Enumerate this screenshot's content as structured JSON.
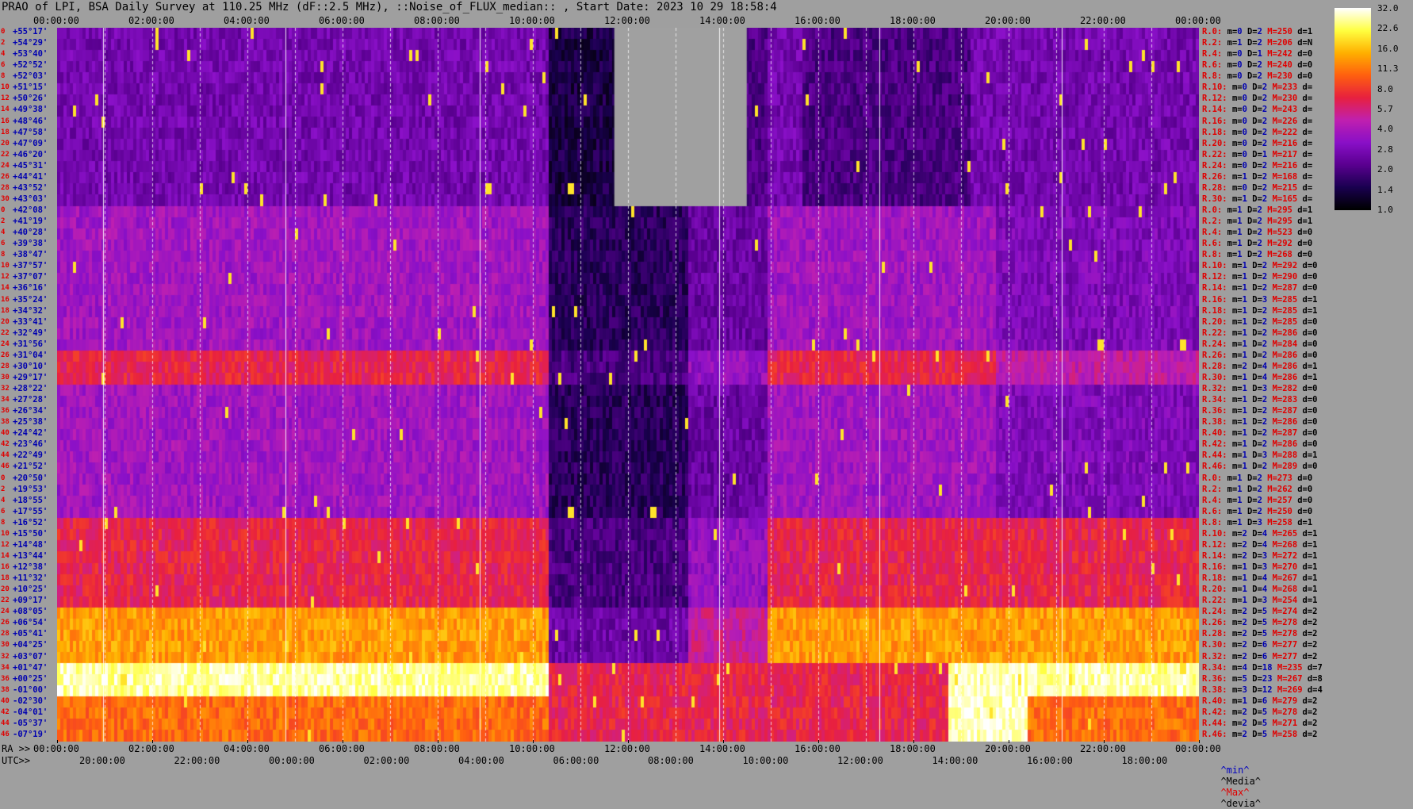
{
  "title": "PRAO of LPI, BSA Daily Survey at 110.25 MHz (dF::2.5 MHz), ::Noise_of_FLUX_median:: , Start Date: 2023 10 29 18:58:4",
  "axes": {
    "top_ticks": [
      "00:00:00",
      "02:00:00",
      "04:00:00",
      "06:00:00",
      "08:00:00",
      "10:00:00",
      "12:00:00",
      "14:00:00",
      "16:00:00",
      "18:00:00",
      "20:00:00",
      "22:00:00",
      "00:00:00"
    ],
    "bottom_ra_prefix": "RA >>",
    "bottom_ra_ticks": [
      "00:00:00",
      "02:00:00",
      "04:00:00",
      "06:00:00",
      "08:00:00",
      "10:00:00",
      "12:00:00",
      "14:00:00",
      "16:00:00",
      "18:00:00",
      "20:00:00",
      "22:00:00",
      "00:00:00"
    ],
    "bottom_utc_prefix": "UTC>>",
    "bottom_utc_ticks": [
      "20:00:00",
      "22:00:00",
      "00:00:00",
      "02:00:00",
      "04:00:00",
      "06:00:00",
      "08:00:00",
      "10:00:00",
      "12:00:00",
      "14:00:00",
      "16:00:00",
      "18:00:00"
    ]
  },
  "colorbar": {
    "ticks": [
      "32.0",
      "22.6",
      "16.0",
      "11.3",
      "8.0",
      "5.7",
      "4.0",
      "2.8",
      "2.0",
      "1.4",
      "1.0"
    ]
  },
  "legend_footer": {
    "min": "^min^",
    "median": "^Media^",
    "max": "^Max^",
    "devia": "^devia^"
  },
  "chart_data": {
    "type": "heatmap",
    "x_axis": "RA 00:00:00 to 24:00:00",
    "declinations": [
      "+55°17'",
      "+54°29'",
      "+53°40'",
      "+52°52'",
      "+52°03'",
      "+51°15'",
      "+50°26'",
      "+49°38'",
      "+48°46'",
      "+47°58'",
      "+47°09'",
      "+46°20'",
      "+45°31'",
      "+44°41'",
      "+43°52'",
      "+43°03'",
      "+42°08'",
      "+41°19'",
      "+40°28'",
      "+39°38'",
      "+38°47'",
      "+37°57'",
      "+37°07'",
      "+36°16'",
      "+35°24'",
      "+34°32'",
      "+33°41'",
      "+32°49'",
      "+31°56'",
      "+31°04'",
      "+30°10'",
      "+29°17'",
      "+28°22'",
      "+27°28'",
      "+26°34'",
      "+25°38'",
      "+24°42'",
      "+23°46'",
      "+22°49'",
      "+21°52'",
      "+20°50'",
      "+19°53'",
      "+18°55'",
      "+17°55'",
      "+16°52'",
      "+15°50'",
      "+14°48'",
      "+13°44'",
      "+12°38'",
      "+11°32'",
      "+10°25'",
      "+09°17'",
      "+08°05'",
      "+06°54'",
      "+05°41'",
      "+04°25'",
      "+03°07'",
      "+01°47'",
      "+00°25'",
      "-01°00'",
      "-02°30'",
      "-04°01'",
      "-05°37'",
      "-07°19'"
    ],
    "row_numbers": [
      "0",
      "2",
      "4",
      "6",
      "8",
      "10",
      "12",
      "14",
      "16",
      "18",
      "20",
      "22",
      "24",
      "26",
      "28",
      "30",
      "0",
      "2",
      "4",
      "6",
      "8",
      "10",
      "12",
      "14",
      "16",
      "18",
      "20",
      "22",
      "24",
      "26",
      "28",
      "30",
      "32",
      "34",
      "36",
      "38",
      "40",
      "42",
      "44",
      "46",
      "0",
      "2",
      "4",
      "6",
      "8",
      "10",
      "12",
      "14",
      "16",
      "18",
      "20",
      "22",
      "24",
      "26",
      "28",
      "30",
      "32",
      "34",
      "36",
      "38",
      "40",
      "42",
      "44",
      "46"
    ],
    "stats": [
      {
        "r": "R.0:",
        "m": "0",
        "D": "2",
        "M": "250",
        "d": "1"
      },
      {
        "r": "R.2:",
        "m": "1",
        "D": "2",
        "M": "206",
        "d": "N"
      },
      {
        "r": "R.4:",
        "m": "0",
        "D": "1",
        "M": "242",
        "d": "0"
      },
      {
        "r": "R.6:",
        "m": "0",
        "D": "2",
        "M": "240",
        "d": "0"
      },
      {
        "r": "R.8:",
        "m": "0",
        "D": "2",
        "M": "230",
        "d": "0"
      },
      {
        "r": "R.10:",
        "m": "0",
        "D": "2",
        "M": "233",
        "d": ""
      },
      {
        "r": "R.12:",
        "m": "0",
        "D": "2",
        "M": "230",
        "d": ""
      },
      {
        "r": "R.14:",
        "m": "0",
        "D": "2",
        "M": "243",
        "d": ""
      },
      {
        "r": "R.16:",
        "m": "0",
        "D": "2",
        "M": "226",
        "d": ""
      },
      {
        "r": "R.18:",
        "m": "0",
        "D": "2",
        "M": "222",
        "d": ""
      },
      {
        "r": "R.20:",
        "m": "0",
        "D": "2",
        "M": "216",
        "d": ""
      },
      {
        "r": "R.22:",
        "m": "0",
        "D": "1",
        "M": "217",
        "d": ""
      },
      {
        "r": "R.24:",
        "m": "0",
        "D": "2",
        "M": "216",
        "d": ""
      },
      {
        "r": "R.26:",
        "m": "1",
        "D": "2",
        "M": "168",
        "d": ""
      },
      {
        "r": "R.28:",
        "m": "0",
        "D": "2",
        "M": "215",
        "d": ""
      },
      {
        "r": "R.30:",
        "m": "1",
        "D": "2",
        "M": "165",
        "d": ""
      },
      {
        "r": "R.0:",
        "m": "1",
        "D": "2",
        "M": "295",
        "d": "1"
      },
      {
        "r": "R.2:",
        "m": "1",
        "D": "2",
        "M": "295",
        "d": "1"
      },
      {
        "r": "R.4:",
        "m": "1",
        "D": "2",
        "M": "523",
        "d": "0"
      },
      {
        "r": "R.6:",
        "m": "1",
        "D": "2",
        "M": "292",
        "d": "0"
      },
      {
        "r": "R.8:",
        "m": "1",
        "D": "2",
        "M": "268",
        "d": "0"
      },
      {
        "r": "R.10:",
        "m": "1",
        "D": "2",
        "M": "292",
        "d": "0"
      },
      {
        "r": "R.12:",
        "m": "1",
        "D": "2",
        "M": "290",
        "d": "0"
      },
      {
        "r": "R.14:",
        "m": "1",
        "D": "2",
        "M": "287",
        "d": "0"
      },
      {
        "r": "R.16:",
        "m": "1",
        "D": "3",
        "M": "285",
        "d": "1"
      },
      {
        "r": "R.18:",
        "m": "1",
        "D": "2",
        "M": "285",
        "d": "1"
      },
      {
        "r": "R.20:",
        "m": "1",
        "D": "2",
        "M": "285",
        "d": "0"
      },
      {
        "r": "R.22:",
        "m": "1",
        "D": "2",
        "M": "286",
        "d": "0"
      },
      {
        "r": "R.24:",
        "m": "1",
        "D": "2",
        "M": "284",
        "d": "0"
      },
      {
        "r": "R.26:",
        "m": "1",
        "D": "2",
        "M": "286",
        "d": "0"
      },
      {
        "r": "R.28:",
        "m": "2",
        "D": "4",
        "M": "286",
        "d": "1"
      },
      {
        "r": "R.30:",
        "m": "1",
        "D": "4",
        "M": "286",
        "d": "1"
      },
      {
        "r": "R.32:",
        "m": "1",
        "D": "3",
        "M": "282",
        "d": "0"
      },
      {
        "r": "R.34:",
        "m": "1",
        "D": "2",
        "M": "283",
        "d": "0"
      },
      {
        "r": "R.36:",
        "m": "1",
        "D": "2",
        "M": "287",
        "d": "0"
      },
      {
        "r": "R.38:",
        "m": "1",
        "D": "2",
        "M": "286",
        "d": "0"
      },
      {
        "r": "R.40:",
        "m": "1",
        "D": "2",
        "M": "287",
        "d": "0"
      },
      {
        "r": "R.42:",
        "m": "1",
        "D": "2",
        "M": "286",
        "d": "0"
      },
      {
        "r": "R.44:",
        "m": "1",
        "D": "3",
        "M": "288",
        "d": "1"
      },
      {
        "r": "R.46:",
        "m": "1",
        "D": "2",
        "M": "289",
        "d": "0"
      },
      {
        "r": "R.0:",
        "m": "1",
        "D": "2",
        "M": "273",
        "d": "0"
      },
      {
        "r": "R.2:",
        "m": "1",
        "D": "2",
        "M": "262",
        "d": "0"
      },
      {
        "r": "R.4:",
        "m": "1",
        "D": "2",
        "M": "257",
        "d": "0"
      },
      {
        "r": "R.6:",
        "m": "1",
        "D": "2",
        "M": "250",
        "d": "0"
      },
      {
        "r": "R.8:",
        "m": "1",
        "D": "3",
        "M": "258",
        "d": "1"
      },
      {
        "r": "R.10:",
        "m": "2",
        "D": "4",
        "M": "265",
        "d": "1"
      },
      {
        "r": "R.12:",
        "m": "2",
        "D": "4",
        "M": "268",
        "d": "1"
      },
      {
        "r": "R.14:",
        "m": "2",
        "D": "3",
        "M": "272",
        "d": "1"
      },
      {
        "r": "R.16:",
        "m": "1",
        "D": "3",
        "M": "270",
        "d": "1"
      },
      {
        "r": "R.18:",
        "m": "1",
        "D": "4",
        "M": "267",
        "d": "1"
      },
      {
        "r": "R.20:",
        "m": "1",
        "D": "4",
        "M": "268",
        "d": "1"
      },
      {
        "r": "R.22:",
        "m": "1",
        "D": "3",
        "M": "254",
        "d": "1"
      },
      {
        "r": "R.24:",
        "m": "2",
        "D": "5",
        "M": "274",
        "d": "2"
      },
      {
        "r": "R.26:",
        "m": "2",
        "D": "5",
        "M": "278",
        "d": "2"
      },
      {
        "r": "R.28:",
        "m": "2",
        "D": "5",
        "M": "278",
        "d": "2"
      },
      {
        "r": "R.30:",
        "m": "2",
        "D": "6",
        "M": "277",
        "d": "2"
      },
      {
        "r": "R.32:",
        "m": "2",
        "D": "6",
        "M": "277",
        "d": "2"
      },
      {
        "r": "R.34:",
        "m": "4",
        "D": "18",
        "M": "235",
        "d": "7"
      },
      {
        "r": "R.36:",
        "m": "5",
        "D": "23",
        "M": "267",
        "d": "8"
      },
      {
        "r": "R.38:",
        "m": "3",
        "D": "12",
        "M": "269",
        "d": "4"
      },
      {
        "r": "R.40:",
        "m": "1",
        "D": "6",
        "M": "279",
        "d": "2"
      },
      {
        "r": "R.42:",
        "m": "2",
        "D": "5",
        "M": "278",
        "d": "2"
      },
      {
        "r": "R.44:",
        "m": "2",
        "D": "5",
        "M": "271",
        "d": "2"
      },
      {
        "r": "R.46:",
        "m": "2",
        "D": "5",
        "M": "258",
        "d": "2"
      }
    ],
    "colormap": [
      "#000000",
      "#1a0050",
      "#5a0090",
      "#8a10c8",
      "#c020b0",
      "#e82040",
      "#ff6010",
      "#ffb000",
      "#ffff40",
      "#ffffff"
    ],
    "color_range": [
      1.0,
      32.0
    ],
    "log_scale": true
  }
}
